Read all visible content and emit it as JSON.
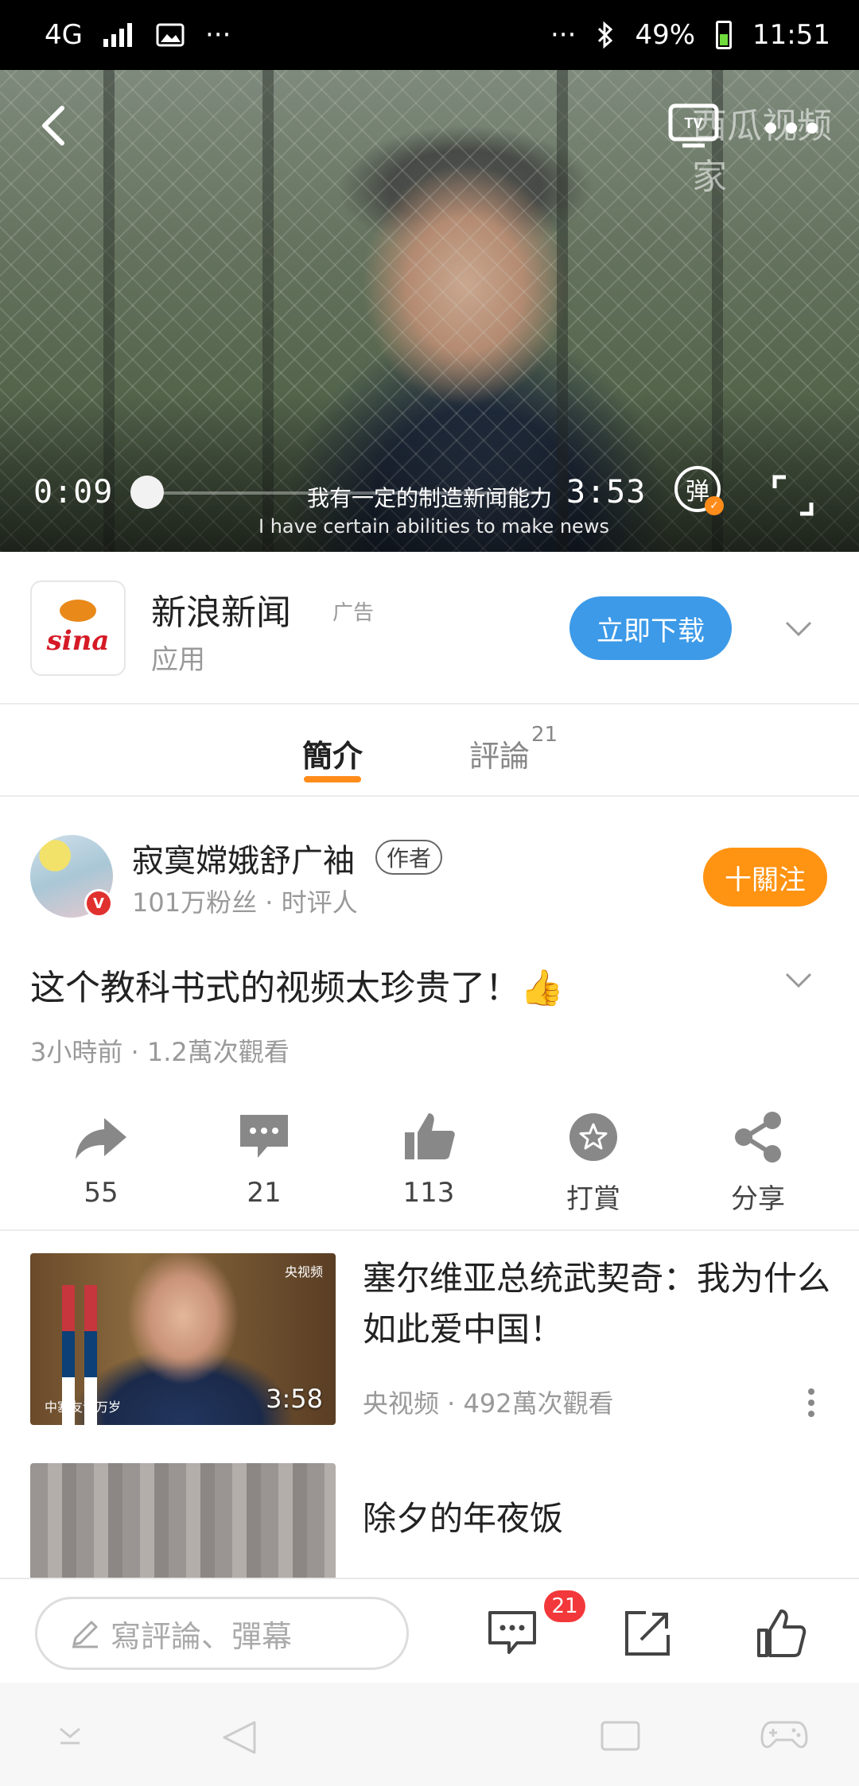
{
  "status_bar": {
    "network": "4G",
    "battery": "49%",
    "time": "11:51",
    "overflow": "···"
  },
  "video": {
    "watermark": "西瓜视频家",
    "current_time": "0:09",
    "total_time": "3:53",
    "progress": 0.04,
    "subtitle_zh": "我有一定的制造新闻能力",
    "subtitle_en": "I have certain abilities to make news",
    "danmu_label": "弹"
  },
  "ad": {
    "logo_text": "sina",
    "title": "新浪新闻",
    "tag": "广告",
    "subtitle": "应用",
    "button": "立即下载"
  },
  "tabs": {
    "intro": "簡介",
    "comments": "評論",
    "comments_count": "21"
  },
  "author": {
    "name": "寂寞嫦娥舒广袖",
    "tag": "作者",
    "meta": "101万粉丝 · 时评人",
    "badge": "V",
    "follow_button": "十關注"
  },
  "video_info": {
    "title": "这个教科书式的视频太珍贵了！👍",
    "meta": "3小時前 · 1.2萬次觀看"
  },
  "actions": [
    {
      "icon": "share-arrow-icon",
      "label": "55"
    },
    {
      "icon": "comment-icon",
      "label": "21"
    },
    {
      "icon": "thumbs-up-icon",
      "label": "113"
    },
    {
      "icon": "star-reward-icon",
      "label": "打賞"
    },
    {
      "icon": "share-nodes-icon",
      "label": "分享"
    }
  ],
  "related": [
    {
      "title": "塞尔维亚总统武契奇：我为什么如此爱中国！",
      "meta": "央视频 · 492萬次觀看",
      "duration": "3:58",
      "brand": "央视频",
      "caption": "中塞友谊万岁"
    },
    {
      "title": "除夕的年夜饭",
      "meta": ""
    }
  ],
  "comment_bar": {
    "placeholder": "寫評論、彈幕",
    "badge": "21"
  },
  "colors": {
    "accent_orange": "#ff9312",
    "download_blue": "#3d9ae8",
    "badge_red": "#f2383a"
  }
}
